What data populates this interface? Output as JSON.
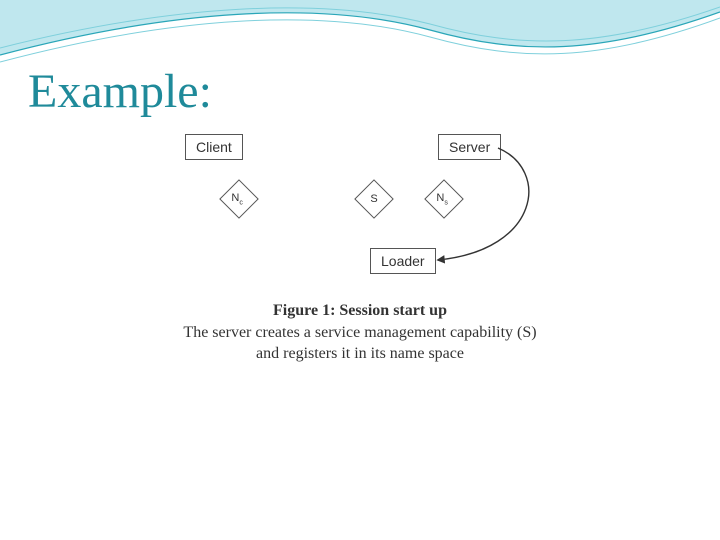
{
  "title": "Example:",
  "diagram": {
    "client_label": "Client",
    "server_label": "Server",
    "loader_label": "Loader",
    "nc_label": "N",
    "nc_sub": "c",
    "s_label": "S",
    "ns_label": "N",
    "ns_sub": "s"
  },
  "caption": {
    "figure": "Figure 1: Session start up",
    "line2": "The server creates a service management capability (S)",
    "line3": "and registers it in its name space"
  }
}
